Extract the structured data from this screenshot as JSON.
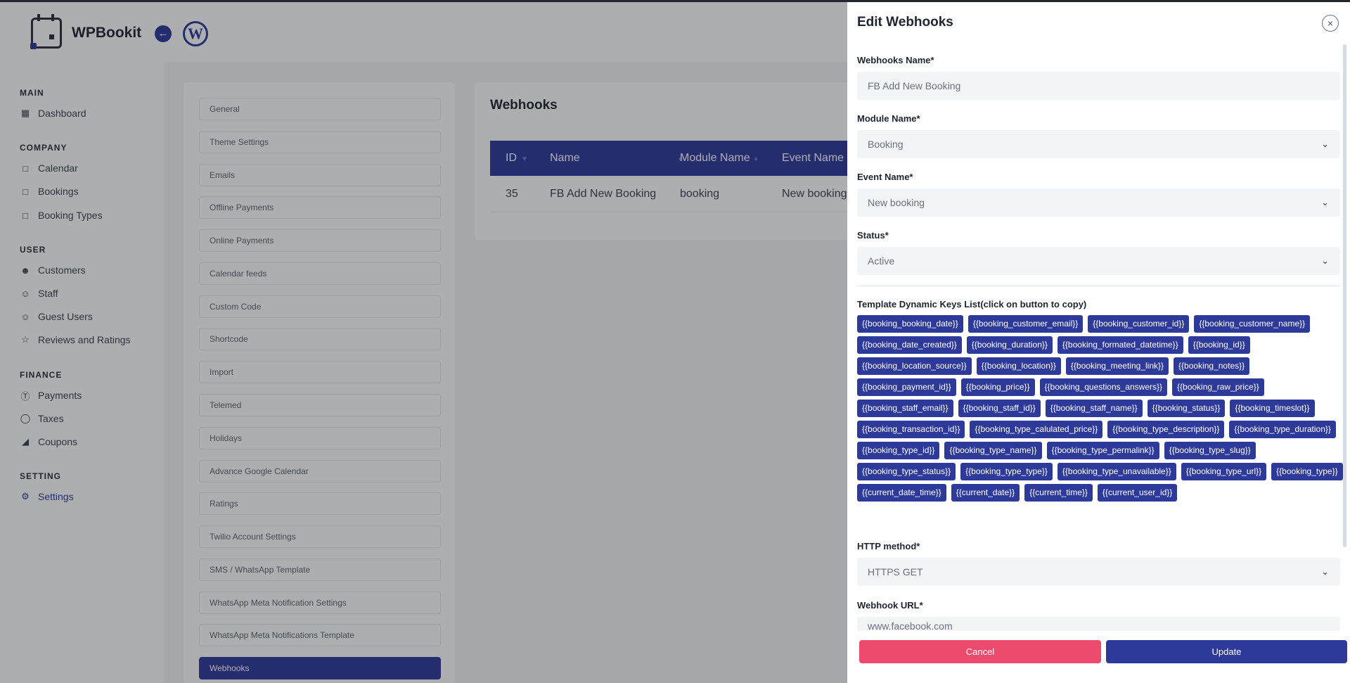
{
  "app": {
    "brand": "WPBookit"
  },
  "sidebar": {
    "sections": [
      {
        "label": "MAIN",
        "items": [
          {
            "label": "Dashboard",
            "icon": "grid-icon"
          }
        ]
      },
      {
        "label": "COMPANY",
        "items": [
          {
            "label": "Calendar",
            "icon": "calendar-icon"
          },
          {
            "label": "Bookings",
            "icon": "calendar-icon"
          },
          {
            "label": "Booking Types",
            "icon": "calendar-icon"
          }
        ]
      },
      {
        "label": "USER",
        "items": [
          {
            "label": "Customers",
            "icon": "users-icon"
          },
          {
            "label": "Staff",
            "icon": "user-icon"
          },
          {
            "label": "Guest Users",
            "icon": "user-icon"
          },
          {
            "label": "Reviews and Ratings",
            "icon": "star-icon"
          }
        ]
      },
      {
        "label": "FINANCE",
        "items": [
          {
            "label": "Payments",
            "icon": "dollar-icon"
          },
          {
            "label": "Taxes",
            "icon": "coin-icon"
          },
          {
            "label": "Coupons",
            "icon": "tag-icon"
          }
        ]
      },
      {
        "label": "SETTING",
        "items": [
          {
            "label": "Settings",
            "icon": "gear-icon",
            "active": true
          }
        ]
      }
    ]
  },
  "settings_menu": [
    "General",
    "Theme Settings",
    "Emails",
    "Offline Payments",
    "Online Payments",
    "Calendar feeds",
    "Custom Code",
    "Shortcode",
    "Import",
    "Telemed",
    "Holidays",
    "Advance Google Calendar",
    "Ratings",
    "Twilio Account Settings",
    "SMS / WhatsApp Template",
    "WhatsApp Meta Notification Settings",
    "WhatsApp Meta Notifications Template",
    "Webhooks"
  ],
  "webhooks_table": {
    "title": "Webhooks",
    "columns": [
      "ID",
      "Name",
      "Module Name",
      "Event Name"
    ],
    "rows": [
      [
        "35",
        "FB Add New Booking",
        "booking",
        "New booking"
      ]
    ]
  },
  "drawer": {
    "title": "Edit Webhooks",
    "close": "×",
    "name_label": "Webhooks Name*",
    "name_value": "FB Add New Booking",
    "module_label": "Module Name*",
    "module_value": "Booking",
    "event_label": "Event Name*",
    "event_value": "New booking",
    "status_label": "Status*",
    "status_value": "Active",
    "keys_label": "Template Dynamic Keys List(click on button to copy)",
    "keys": [
      "{{booking_booking_date}}",
      "{{booking_customer_email}}",
      "{{booking_customer_id}}",
      "{{booking_customer_name}}",
      "{{booking_date_created}}",
      "{{booking_duration}}",
      "{{booking_formated_datetime}}",
      "{{booking_id}}",
      "{{booking_location_source}}",
      "{{booking_location}}",
      "{{booking_meeting_link}}",
      "{{booking_notes}}",
      "{{booking_payment_id}}",
      "{{booking_price}}",
      "{{booking_questions_answers}}",
      "{{booking_raw_price}}",
      "{{booking_staff_email}}",
      "{{booking_staff_id}}",
      "{{booking_staff_name}}",
      "{{booking_status}}",
      "{{booking_timeslot}}",
      "{{booking_transaction_id}}",
      "{{booking_type_calulated_price}}",
      "{{booking_type_description}}",
      "{{booking_type_duration}}",
      "{{booking_type_id}}",
      "{{booking_type_name}}",
      "{{booking_type_permalink}}",
      "{{booking_type_slug}}",
      "{{booking_type_status}}",
      "{{booking_type_type}}",
      "{{booking_type_unavailable}}",
      "{{booking_type_url}}",
      "{{booking_type}}",
      "{{current_date_time}}",
      "{{current_date}}",
      "{{current_time}}",
      "{{current_user_id}}"
    ],
    "http_label": "HTTP method*",
    "http_value": "HTTPS GET",
    "url_label": "Webhook URL*",
    "url_value": "www.facebook.com",
    "cancel": "Cancel",
    "update": "Update"
  },
  "colors": {
    "primary": "#2e3a9a",
    "danger": "#ee4a6e"
  }
}
